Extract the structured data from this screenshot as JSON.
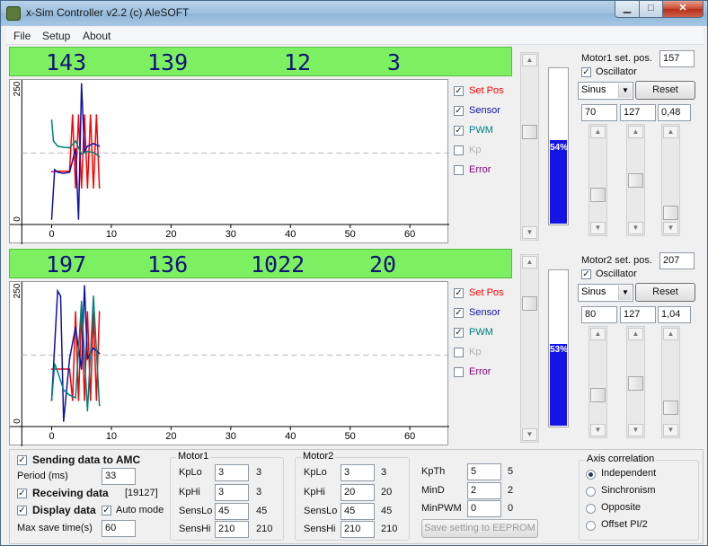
{
  "window": {
    "title": "x-Sim Controller v2.2 (c) AleSOFT",
    "min": "▁",
    "max": "□",
    "close": "✕"
  },
  "menu": [
    "File",
    "Setup",
    "About"
  ],
  "icons": {
    "scroll_up": "▲",
    "scroll_down": "▼",
    "dropdown": "▼",
    "check": "✓"
  },
  "colors": {
    "setpos": "#ff0000",
    "sensor": "#1010a8",
    "pwm": "#008080",
    "kp": "#b0b0b0",
    "error": "#800080",
    "readout_bg": "#7cf060",
    "progress": "#1414e6"
  },
  "motor1": {
    "readout": [
      "143",
      "139",
      "12",
      "3"
    ],
    "legend": [
      {
        "label": "Set Pos",
        "checked": true
      },
      {
        "label": "Sensor",
        "checked": true
      },
      {
        "label": "PWM",
        "checked": true
      },
      {
        "label": "Kp",
        "checked": false
      },
      {
        "label": "Error",
        "checked": false
      }
    ],
    "set_pos_label": "Motor1 set. pos.",
    "set_pos_value": "157",
    "oscillator_label": "Oscillator",
    "oscillator_checked": true,
    "waveform": "Sinus",
    "reset_label": "Reset",
    "params": [
      "70",
      "127",
      "0,48"
    ],
    "progress_text": "54%",
    "progress_value": 54
  },
  "motor2": {
    "readout": [
      "197",
      "136",
      "1022",
      "20"
    ],
    "legend": [
      {
        "label": "Set Pos",
        "checked": true
      },
      {
        "label": "Sensor",
        "checked": true
      },
      {
        "label": "PWM",
        "checked": true
      },
      {
        "label": "Kp",
        "checked": false
      },
      {
        "label": "Error",
        "checked": false
      }
    ],
    "set_pos_label": "Motor2 set. pos.",
    "set_pos_value": "207",
    "oscillator_label": "Oscillator",
    "oscillator_checked": true,
    "waveform": "Sinus",
    "reset_label": "Reset",
    "params": [
      "80",
      "127",
      "1,04"
    ],
    "progress_text": "53%",
    "progress_value": 53
  },
  "chart_data": [
    {
      "type": "line",
      "x_ticks": [
        "0",
        "10",
        "20",
        "30",
        "40",
        "50",
        "60"
      ],
      "y_ticks": [
        "0",
        "250"
      ],
      "xlim": [
        -7,
        66
      ],
      "ylim": [
        0,
        250
      ],
      "threshold": 127,
      "series": [
        {
          "name": "Set Pos",
          "color": "#ff0000",
          "x": [
            0,
            1,
            2,
            3,
            3.5,
            4,
            4.5,
            5,
            5.5,
            6,
            6.5,
            7,
            7.5,
            8
          ],
          "y": [
            91,
            92,
            92,
            92,
            200,
            60,
            200,
            60,
            200,
            60,
            200,
            60,
            200,
            60
          ]
        },
        {
          "name": "Sensor",
          "color": "#1010a8",
          "x": [
            0,
            0.5,
            1,
            2,
            3,
            4,
            4.5,
            5,
            5.5,
            6,
            7,
            8
          ],
          "y": [
            0,
            95,
            90,
            88,
            90,
            135,
            0,
            260,
            130,
            140,
            145,
            140
          ]
        },
        {
          "name": "PWM",
          "color": "#008080",
          "x": [
            0,
            0.3,
            1,
            2,
            3,
            4,
            5,
            6,
            7,
            8
          ],
          "y": [
            190,
            150,
            140,
            138,
            137,
            150,
            125,
            130,
            128,
            120
          ]
        }
      ]
    },
    {
      "type": "line",
      "x_ticks": [
        "0",
        "10",
        "20",
        "30",
        "40",
        "50",
        "60"
      ],
      "y_ticks": [
        "0",
        "250"
      ],
      "xlim": [
        -7,
        66
      ],
      "ylim": [
        0,
        250
      ],
      "threshold": 127,
      "series": [
        {
          "name": "Set Pos",
          "color": "#ff0000",
          "x": [
            0,
            2,
            3,
            3.5,
            4,
            4.5,
            5,
            5.5,
            6,
            6.5,
            7,
            7.5,
            8
          ],
          "y": [
            100,
            100,
            100,
            40,
            210,
            40,
            210,
            40,
            210,
            40,
            210,
            40,
            210
          ]
        },
        {
          "name": "Sensor",
          "color": "#1010a8",
          "x": [
            0,
            1,
            1.5,
            2,
            3,
            4,
            5,
            5.5,
            6,
            7,
            8
          ],
          "y": [
            40,
            250,
            240,
            0,
            120,
            180,
            100,
            260,
            120,
            140,
            130
          ]
        },
        {
          "name": "PWM",
          "color": "#008080",
          "x": [
            0,
            0.5,
            1,
            2,
            3,
            4,
            5,
            6,
            7,
            8
          ],
          "y": [
            40,
            110,
            95,
            60,
            50,
            45,
            230,
            20,
            240,
            30
          ]
        }
      ]
    }
  ],
  "bottom": {
    "sending_label": "Sending data to AMC",
    "period_label": "Period (ms)",
    "period_value": "33",
    "receiving_label": "Receiving data",
    "receiving_count": "[19127]",
    "display_label": "Display data",
    "auto_mode_label": "Auto mode",
    "max_save_label": "Max save time(s)",
    "max_save_value": "60",
    "motor1_group": {
      "title": "Motor1",
      "rows": [
        {
          "label": "KpLo",
          "input": "3",
          "value": "3"
        },
        {
          "label": "KpHi",
          "input": "3",
          "value": "3"
        },
        {
          "label": "SensLo",
          "input": "45",
          "value": "45"
        },
        {
          "label": "SensHi",
          "input": "210",
          "value": "210"
        }
      ]
    },
    "motor2_group": {
      "title": "Motor2",
      "rows": [
        {
          "label": "KpLo",
          "input": "3",
          "value": "3"
        },
        {
          "label": "KpHi",
          "input": "20",
          "value": "20"
        },
        {
          "label": "SensLo",
          "input": "45",
          "value": "45"
        },
        {
          "label": "SensHi",
          "input": "210",
          "value": "210"
        }
      ]
    },
    "misc_rows": [
      {
        "label": "KpTh",
        "input": "5",
        "value": "5"
      },
      {
        "label": "MinD",
        "input": "2",
        "value": "2"
      },
      {
        "label": "MinPWM",
        "input": "0",
        "value": "0"
      }
    ],
    "save_button": "Save setting to EEPROM",
    "axis_correlation": {
      "title": "Axis correlation",
      "options": [
        "Independent",
        "Sinchronism",
        "Opposite",
        "Offset PI/2"
      ],
      "selected": 0
    }
  }
}
